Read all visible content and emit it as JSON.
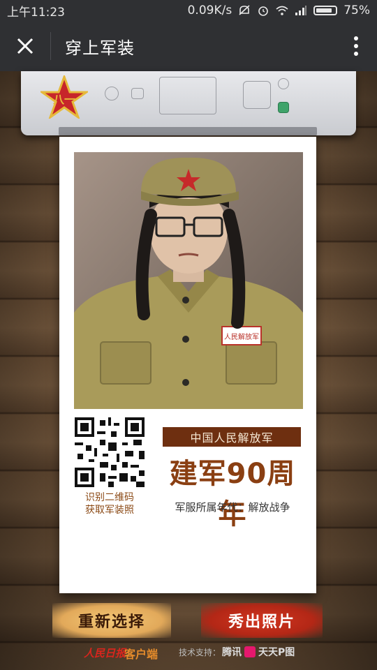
{
  "status_bar": {
    "time": "上午11:23",
    "network_speed": "0.09K/s",
    "battery": "75%",
    "icons": [
      "mute-icon",
      "alarm-icon",
      "wifi-icon",
      "signal-icon",
      "battery-icon"
    ]
  },
  "header": {
    "title": "穿上军装",
    "close_icon": "close-icon",
    "more_icon": "more-vertical-icon"
  },
  "poster": {
    "qr_caption_line1": "识别二维码",
    "qr_caption_line2": "获取军装照",
    "banner": "中国人民解放军",
    "headline": "建军90周年",
    "era": "军服所属年代：解放战争",
    "photo_badge": "人民解放军"
  },
  "actions": {
    "reselect": "重新选择",
    "show_photo": "秀出照片"
  },
  "footer": {
    "logo": "人民日报",
    "client": "客户端",
    "tech_support": "技术支持：",
    "tencent": "腾讯",
    "ptu": "天天P图"
  },
  "colors": {
    "topbar": "#2f3033",
    "banner_bg": "#6e2f10",
    "headline": "#8a3f12",
    "reselect_btn": "#e8b56a",
    "show_btn": "#c1301b"
  }
}
